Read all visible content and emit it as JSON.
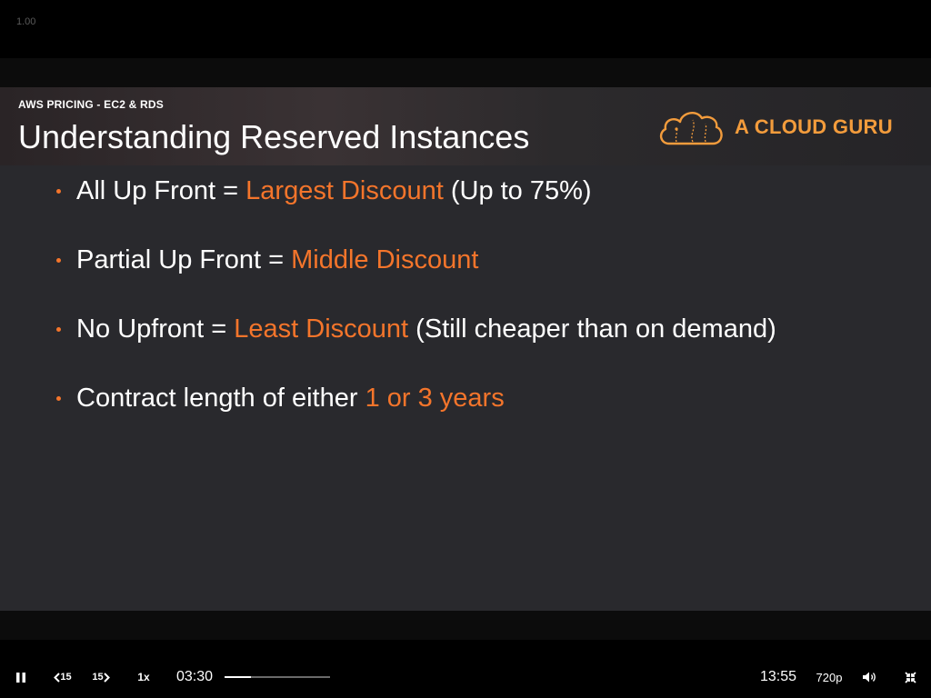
{
  "player": {
    "speed_readout": "1.00"
  },
  "slide": {
    "subtitle": "AWS PRICING - EC2 & RDS",
    "title": "Understanding Reserved Instances",
    "brand": "A CLOUD GURU",
    "bullets": [
      {
        "plain": "All Up Front = ",
        "highlight": "Largest Discount",
        "rest": " (Up to 75%)"
      },
      {
        "plain": "Partial Up Front = ",
        "highlight": "Middle Discount",
        "rest": ""
      },
      {
        "plain": "No Upfront = ",
        "highlight": "Least Discount",
        "rest": " (Still cheaper than on demand)"
      },
      {
        "plain": "Contract length of either ",
        "highlight": "1 or 3 years",
        "rest": ""
      }
    ]
  },
  "controls": {
    "play_state": "pause-icon",
    "rewind_label": "15",
    "forward_label": "15",
    "rate": "1x",
    "current_time": "03:30",
    "duration": "13:55",
    "progress_fraction": 0.251,
    "quality": "720p",
    "volume_icon": "volume-icon",
    "fullscreen_icon": "exit-fullscreen-icon"
  },
  "colors": {
    "accent": "#f4752b",
    "brand": "#f39c3c",
    "slide_bg": "#29292d"
  }
}
